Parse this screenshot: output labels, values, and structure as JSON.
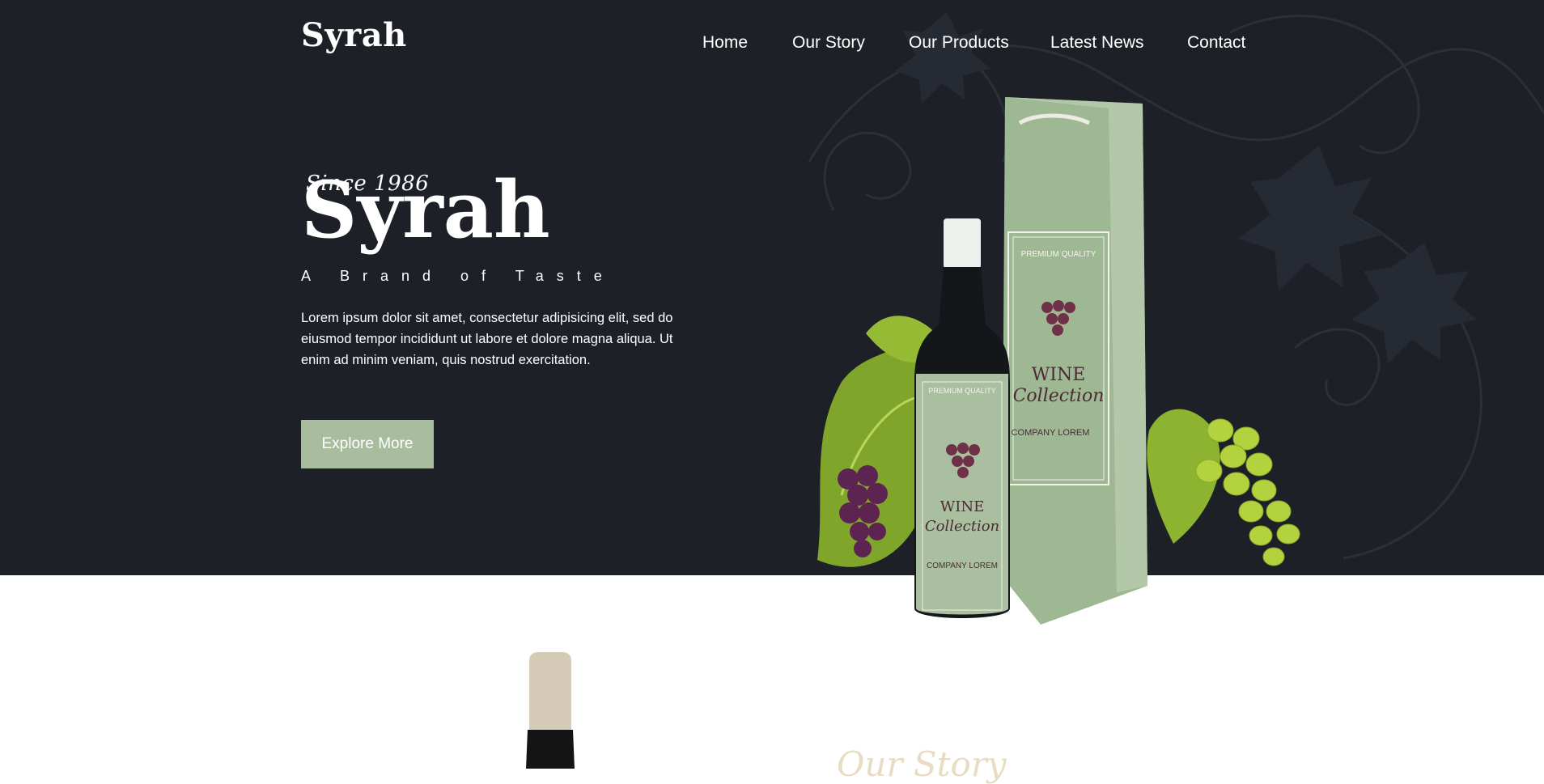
{
  "brand": {
    "logo": "Syrah"
  },
  "nav": {
    "items": [
      "Home",
      "Our Story",
      "Our Products",
      "Latest News",
      "Contact"
    ]
  },
  "hero": {
    "since": "Since 1986",
    "title": "Syrah",
    "tagline": "A Brand of Taste",
    "description": "Lorem ipsum dolor sit amet, consectetur adipisicing elit, sed do eiusmod tempor incididunt ut labore et dolore magna aliqua. Ut enim ad minim veniam, quis nostrud exercitation.",
    "cta_label": "Explore More"
  },
  "product_image": {
    "bottle_label": {
      "premium": "PREMIUM QUALITY",
      "line1": "WINE",
      "line2": "Collection",
      "company": "COMPANY LOREM"
    },
    "bag_label": {
      "premium": "PREMIUM QUALITY",
      "line1": "WINE",
      "line2": "Collection",
      "company": "COMPANY LOREM"
    }
  },
  "next_section": {
    "heading_partial": "Our Story"
  },
  "colors": {
    "hero_bg": "#1d2027",
    "accent": "#a7bd9e",
    "text": "#ffffff",
    "label_sage": "#a9bf9f"
  }
}
